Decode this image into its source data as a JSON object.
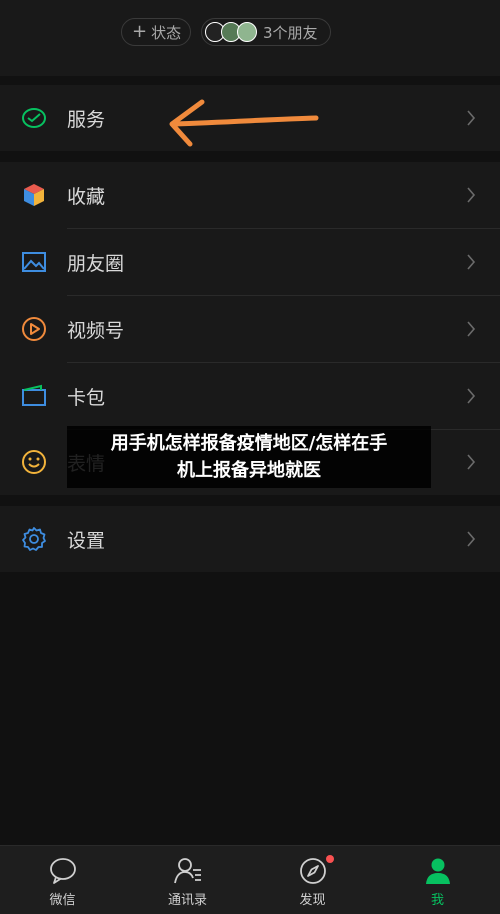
{
  "header": {
    "status_label": "状态",
    "friends_label": "3个朋友"
  },
  "menu": {
    "services": "服务",
    "favorites": "收藏",
    "moments": "朋友圈",
    "channels": "视频号",
    "cards": "卡包",
    "stickers": "表情",
    "settings": "设置"
  },
  "overlay": {
    "line1": "用手机怎样报备疫情地区/怎样在手",
    "line2": "机上报备异地就医"
  },
  "tabs": {
    "chats": "微信",
    "contacts": "通讯录",
    "discover": "发现",
    "me": "我"
  },
  "colors": {
    "accent": "#07c160",
    "arrow": "#f08a3c",
    "badge": "#fa5151"
  }
}
